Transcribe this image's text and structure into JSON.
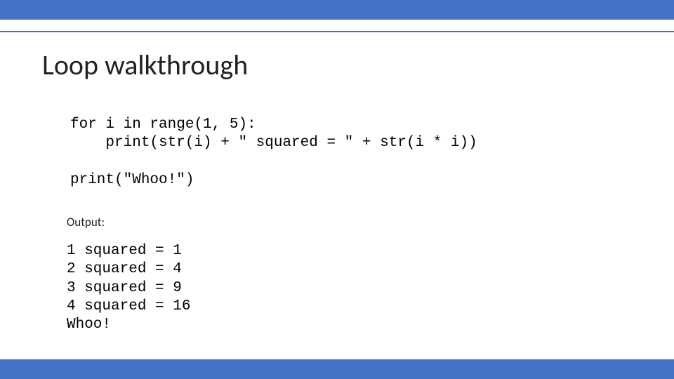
{
  "title": "Loop walkthrough",
  "code": {
    "line1": "for i in range(1, 5):",
    "line2": "    print(str(i) + \" squared = \" + str(i * i))",
    "line3": "",
    "line4": "print(\"Whoo!\")"
  },
  "output_label": "Output:",
  "output": {
    "line1": "1 squared = 1",
    "line2": "2 squared = 4",
    "line3": "3 squared = 9",
    "line4": "4 squared = 16",
    "line5": "Whoo!"
  },
  "colors": {
    "accent": "#4472C4"
  }
}
